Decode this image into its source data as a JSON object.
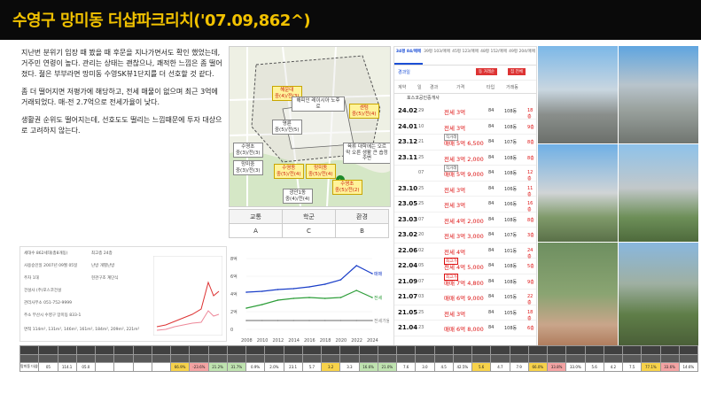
{
  "page": {
    "title": "수영구 망미동 더샵파크리치('07.09,862^)"
  },
  "notes": [
    "지난번 분위기 임장 때 봤을 때 후문을 지나가면서도 확인 했었는데, 거주민 연령이 높다. 관리는 상태는 괜찮으나, 쾌적한 느낌은 좀 떨어졌다. 젊은 부부라면 망미동 수영SK뷰1단지를 더 선호할 것 같다.",
    "좀 더 떨어지면 저평가에 해당하고, 전세 매물이 없으며 최근 3억에 거래되었다. 매-전 2.7억으로 전세가율이 낮다.",
    "생활권 순위도 떨어지는데, 선호도도 떨리는 느낌때문에 투자 대상으로 고려하지 않는다."
  ],
  "map": {
    "labels": [
      {
        "t1": "해운대",
        "t2": "중(4)/전(3)"
      },
      {
        "t1": "센텀",
        "t2": "중(5)/전(4)"
      },
      {
        "t1": "명륜",
        "t2": "중(5)/전(5)"
      },
      {
        "t1": "수영동",
        "t2": "중(5)/전(4)"
      },
      {
        "t1": "망미동",
        "t2": "중(5)/전(4)"
      },
      {
        "t1": "망미중",
        "t2": "중(3)/전(3)"
      },
      {
        "t1": "수영초",
        "t2": "중(5)/전(2)"
      },
      {
        "t1": "수영초",
        "t2": "중(3)/전(3)"
      },
      {
        "t1": "광안1동",
        "t2": "중(4)/전(4)"
      }
    ],
    "callout1": "해피인 레이시아 노후로",
    "callout2": "육류 대학에는 오르막 오른 생활 큰 숍정 주변",
    "badges": [
      "6.1",
      "6.5",
      "6.3",
      "6.1"
    ]
  },
  "rating": {
    "headers": [
      "교통",
      "학군",
      "환경"
    ],
    "values": [
      "A",
      "C",
      "B"
    ]
  },
  "info": {
    "rows": [
      "세대수 862세대(총8개동)",
      "사용승인일 2007년 09월 05일",
      "주차 1대",
      "건설사 (주)포스코건설",
      "관리사무소 051-752-9999",
      "주소 부산시 수영구 망미동 833-1",
      "면적 114m², 131m², 146m², 161m², 184m², 209m², 221m²"
    ],
    "side": [
      "최고층 24층",
      "난방 개별난방",
      "현관구조 계단식"
    ]
  },
  "chart_data": {
    "type": "line",
    "x": [
      2008,
      2010,
      2012,
      2014,
      2016,
      2018,
      2020,
      2022,
      2024
    ],
    "xticks": [
      "2008",
      "2010",
      "2012",
      "2014",
      "2016",
      "2018",
      "2020",
      "2022",
      "2024"
    ],
    "yticks": [
      "8억",
      "6억",
      "4억",
      "2억",
      "0"
    ],
    "ylim": [
      0,
      8
    ],
    "series": [
      {
        "name": "매매",
        "color": "#1a3ec8",
        "values": [
          4.2,
          4.3,
          4.5,
          4.6,
          4.8,
          5.1,
          5.6,
          7.2,
          6.3
        ]
      },
      {
        "name": "전세",
        "color": "#2e9e3a",
        "values": [
          2.4,
          2.8,
          3.3,
          3.5,
          3.6,
          3.5,
          3.6,
          4.4,
          3.6
        ]
      },
      {
        "name": "전세가율",
        "color": "#888888",
        "values": [
          1.0,
          1.0,
          1.0,
          1.0,
          1.0,
          1.0,
          1.0,
          1.0,
          1.0
        ]
      }
    ]
  },
  "list": {
    "tabs": [
      "34평 84/매매",
      "39평 103/매매",
      "45평 123/매매",
      "48평 152/매매",
      "49평 204/매매"
    ],
    "sort": "경과일",
    "btn1": "동 거래순",
    "btn2": "집 전체",
    "header": [
      "계약",
      "일",
      "경과",
      "가격",
      "타입",
      "거래동"
    ],
    "agent": "포스코공인중개사",
    "rows": [
      {
        "d": "24.02",
        "dd": "29",
        "p": "전세 3억",
        "a": "84",
        "b": "108동",
        "f": "18층",
        "tag": ""
      },
      {
        "d": "24.01",
        "dd": "10",
        "p": "전세 3억",
        "a": "84",
        "b": "108동",
        "f": "9층",
        "tag": ""
      },
      {
        "d": "23.12",
        "dd": "21",
        "p": "매매 5억 6,500",
        "a": "84",
        "b": "107동",
        "f": "8층",
        "tag": "직거래"
      },
      {
        "d": "23.11",
        "dd": "25",
        "p": "전세 3억 2,000",
        "a": "84",
        "b": "108동",
        "f": "8층",
        "tag": ""
      },
      {
        "d": "",
        "dd": "07",
        "p": "매매 5억 9,000",
        "a": "84",
        "b": "108동",
        "f": "12층",
        "tag": "직거래"
      },
      {
        "d": "23.10",
        "dd": "25",
        "p": "전세 3억",
        "a": "84",
        "b": "106동",
        "f": "11층",
        "tag": ""
      },
      {
        "d": "23.05",
        "dd": "25",
        "p": "전세 3억",
        "a": "84",
        "b": "106동",
        "f": "16층",
        "tag": ""
      },
      {
        "d": "23.03",
        "dd": "07",
        "p": "전세 4억 2,000",
        "a": "84",
        "b": "108동",
        "f": "8층",
        "tag": ""
      },
      {
        "d": "23.02",
        "dd": "20",
        "p": "전세 3억 3,000",
        "a": "84",
        "b": "107동",
        "f": "3층",
        "tag": ""
      },
      {
        "d": "22.06",
        "dd": "02",
        "p": "전세 4억",
        "a": "84",
        "b": "101동",
        "f": "24층",
        "tag": ""
      },
      {
        "d": "22.04",
        "dd": "05",
        "p": "전세 4억 5,000",
        "a": "84",
        "b": "108동",
        "f": "5층",
        "tag": "최고가"
      },
      {
        "d": "21.09",
        "dd": "07",
        "p": "매매 7억 4,800",
        "a": "84",
        "b": "108동",
        "f": "9층",
        "tag": "최고가"
      },
      {
        "d": "21.07",
        "dd": "03",
        "p": "매매 6억 9,000",
        "a": "84",
        "b": "105동",
        "f": "22층",
        "tag": ""
      },
      {
        "d": "21.05",
        "dd": "25",
        "p": "전세 3억",
        "a": "84",
        "b": "105동",
        "f": "18층",
        "tag": ""
      },
      {
        "d": "21.04",
        "dd": "23",
        "p": "매매 6억 8,000",
        "a": "84",
        "b": "108동",
        "f": "6층",
        "tag": ""
      }
    ]
  },
  "bottom": {
    "h1": [
      "",
      "",
      "",
      "",
      "",
      "",
      "",
      "",
      "",
      "",
      "",
      "",
      "",
      "",
      "",
      "",
      "",
      "",
      "",
      "",
      "",
      "",
      "",
      "",
      "",
      "",
      "",
      "",
      "",
      "",
      "",
      "",
      "",
      "",
      "",
      ""
    ],
    "row": [
      "망미동 더샵파크리치('07.09,862^)",
      "05",
      "114.1",
      "05.0",
      "",
      "",
      "",
      "",
      "66.9%",
      "-23.6%",
      "21.2%",
      "31.7%",
      "0.9%",
      "2.0%",
      "23.1",
      "5.7",
      "3.2",
      "3.3",
      "16.6%",
      "21.0%",
      "7.6",
      "3.0",
      "4.5",
      "42.5%",
      "5.6",
      "4.7",
      "7.9",
      "66.0%",
      "33.8%",
      "33.0%",
      "5.6",
      "4.2",
      "7.5",
      "77.1%",
      "33.6%",
      "14.6%"
    ]
  }
}
